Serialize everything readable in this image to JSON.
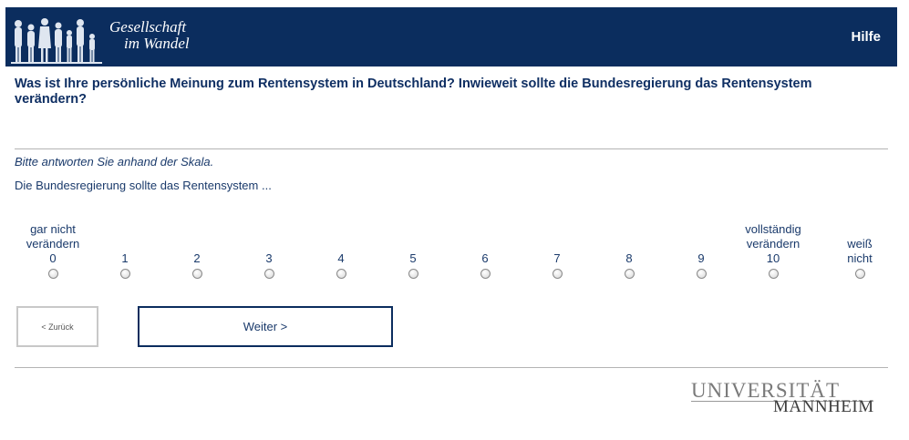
{
  "header": {
    "brand_line1": "Gesellschaft",
    "brand_line2": "im Wandel",
    "help_label": "Hilfe",
    "bg_color": "#0b2d5e"
  },
  "question": "Was ist Ihre persönliche Meinung zum Rentensystem in Deutschland? Inwieweit sollte die Bundesregierung das Rentensystem verändern?",
  "instruction": "Bitte antworten Sie anhand der Skala.",
  "stem": "Die Bundesregierung sollte das Rentensystem ...",
  "scale": [
    {
      "label": "gar nicht verändern",
      "value": "0"
    },
    {
      "label": "",
      "value": "1"
    },
    {
      "label": "",
      "value": "2"
    },
    {
      "label": "",
      "value": "3"
    },
    {
      "label": "",
      "value": "4"
    },
    {
      "label": "",
      "value": "5"
    },
    {
      "label": "",
      "value": "6"
    },
    {
      "label": "",
      "value": "7"
    },
    {
      "label": "",
      "value": "8"
    },
    {
      "label": "",
      "value": "9"
    },
    {
      "label": "vollständig verändern",
      "value": "10"
    },
    {
      "label": "weiß nicht",
      "value": ""
    }
  ],
  "nav": {
    "back_label": "< Zurück",
    "next_label": "Weiter >"
  },
  "footer": {
    "logo_line1": "UNIVERSITÄT",
    "logo_line2": "MANNHEIM"
  }
}
